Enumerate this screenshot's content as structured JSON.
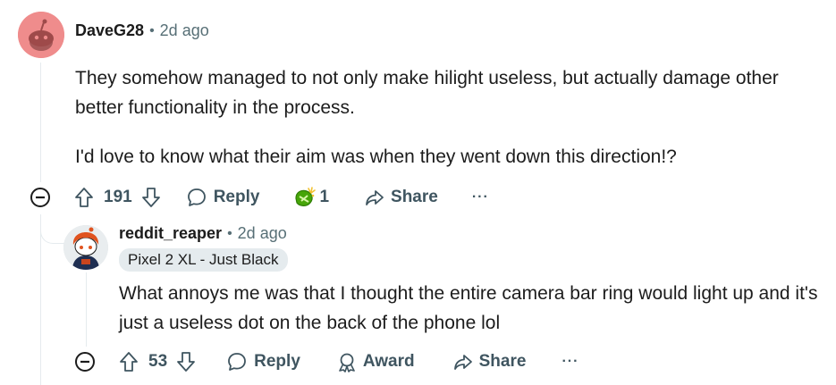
{
  "comment1": {
    "username": "DaveG28",
    "separator": "•",
    "age": "2d ago",
    "paragraphs": [
      "They somehow managed to not only make hilight useless, but actually damage other better functionality in the process.",
      "I'd love to know what their aim was when they went down this direction!?"
    ],
    "score": "191",
    "reply_label": "Reply",
    "award_count": "1",
    "share_label": "Share",
    "more_label": "···",
    "avatar_color": "#ef8c8c"
  },
  "comment2": {
    "username": "reddit_reaper",
    "separator": "•",
    "age": "2d ago",
    "flair": "Pixel 2 XL - Just Black",
    "paragraphs": [
      "What annoys me was that I thought the entire camera bar ring would light up and it's just a useless dot on the back of the phone lol"
    ],
    "score": "53",
    "reply_label": "Reply",
    "award_label": "Award",
    "share_label": "Share",
    "more_label": "···"
  },
  "colors": {
    "text": "#1c1c1c",
    "muted": "#576f76",
    "action": "#3f5560",
    "thread_line": "#e5ebee",
    "flair_bg": "#e5ebee",
    "award_green": "#46a508"
  }
}
